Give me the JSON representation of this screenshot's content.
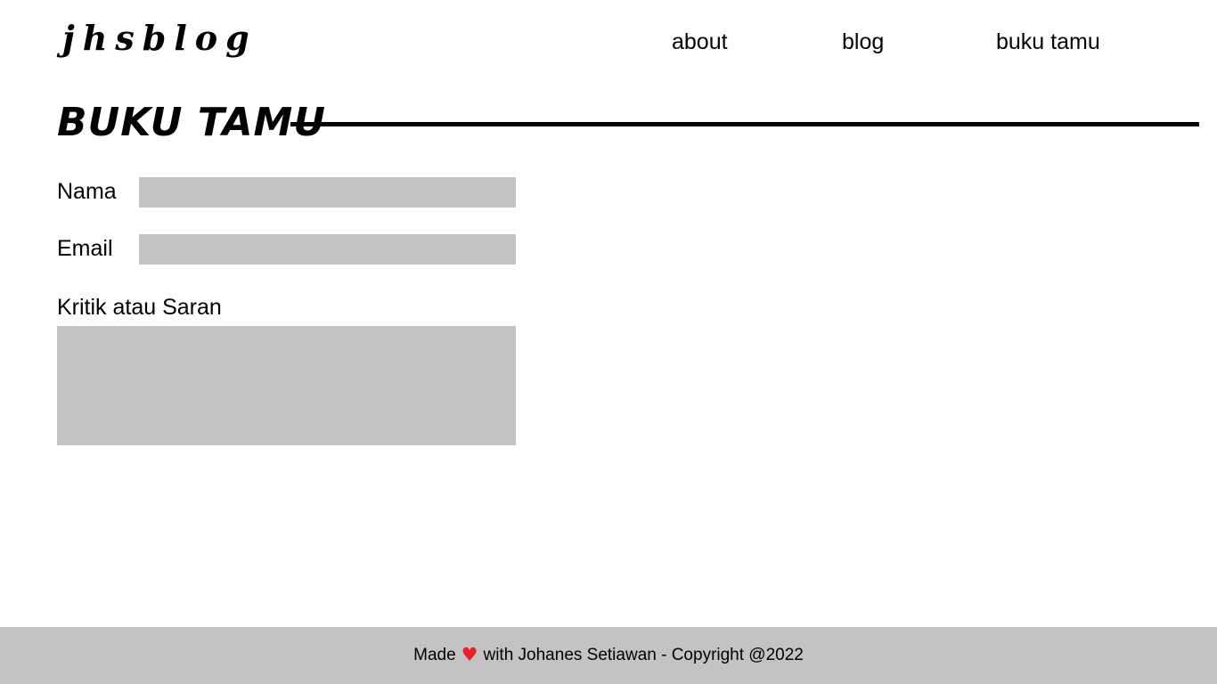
{
  "header": {
    "logo": "jhsblog",
    "nav": {
      "about": "about",
      "blog": "blog",
      "guestbook": "buku tamu"
    }
  },
  "main": {
    "title": "BUKU TAMU",
    "form": {
      "name_label": "Nama",
      "name_value": "",
      "email_label": "Email",
      "email_value": "",
      "message_label": "Kritik atau Saran",
      "message_value": ""
    }
  },
  "footer": {
    "made": "Made",
    "heart_icon": "heart-icon",
    "heart_glyph": "♥",
    "with_text": "with Johanes Setiawan - Copyright @2022"
  },
  "colors": {
    "field_background": "#c3c3c3",
    "footer_background": "#c3c3c3",
    "heart": "#e8202a",
    "text": "#000000"
  }
}
